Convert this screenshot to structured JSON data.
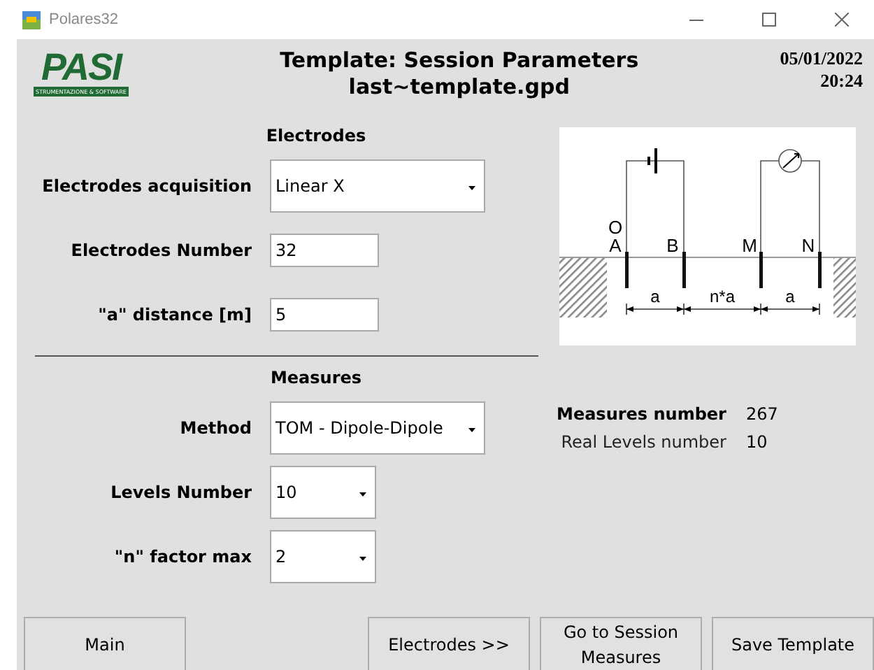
{
  "window": {
    "title": "Polares32"
  },
  "header": {
    "logo_text": "PASI",
    "logo_subtitle": "STRUMENTAZIONE & SOFTWARE",
    "title": "Template: Session Parameters",
    "subtitle": "last~template.gpd",
    "date": "05/01/2022",
    "time": "20:24"
  },
  "electrodes": {
    "heading": "Electrodes",
    "fields": [
      {
        "label": "Electrodes acquisition",
        "kind": "dropdown",
        "value": "Linear X"
      },
      {
        "label": "Electrodes Number",
        "kind": "text",
        "value": "32"
      },
      {
        "label": "\"a\" distance [m]",
        "kind": "text",
        "value": "5"
      }
    ]
  },
  "measures": {
    "heading": "Measures",
    "fields": [
      {
        "label": "Method",
        "kind": "dropdown",
        "value": "TOM - Dipole-Dipole"
      },
      {
        "label": "Levels Number",
        "kind": "small-dropdown",
        "value": "10"
      },
      {
        "label": "\"n\" factor max",
        "kind": "small-dropdown",
        "value": "2"
      }
    ]
  },
  "diagram": {
    "electrode_labels": [
      "A",
      "B",
      "M",
      "N"
    ],
    "origin_label": "O",
    "spacing_labels": [
      "a",
      "n*a",
      "a"
    ]
  },
  "info": [
    {
      "label": "Measures number",
      "value": "267",
      "bold": true
    },
    {
      "label": "Real Levels number",
      "value": "10",
      "bold": false
    }
  ],
  "buttons": [
    "Main",
    "Electrodes >>",
    "Go to Session Measures",
    "Save Template"
  ]
}
